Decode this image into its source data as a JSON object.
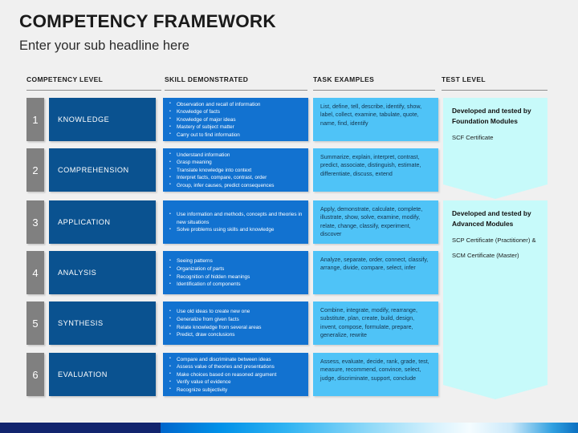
{
  "header": {
    "title": "COMPETENCY FRAMEWORK",
    "subtitle": "Enter your sub headline here"
  },
  "columns": {
    "level": "COMPETENCY LEVEL",
    "skill": "SKILL DEMONSTRATED",
    "task": "TASK EXAMPLES",
    "test": "TEST LEVEL"
  },
  "colors": {
    "background": "#f0f0f0",
    "number_box": "#808080",
    "level_box": "#0A5290",
    "skill_box": "#1272D0",
    "task_box": "#4FC3F7",
    "banner": "#C7FAFA",
    "bar_navy": "#12246e"
  },
  "rows": [
    {
      "number": "1",
      "level": "KNOWLEDGE",
      "skills": [
        "Observation and recall of information",
        "Knowledge of facts",
        "Knowledge of major ideas",
        "Mastery of subject matter",
        "Carry out to find information"
      ],
      "tasks": "List, define, tell, describe, identify, show, label, collect, examine, tabulate, quote, name, find, identify"
    },
    {
      "number": "2",
      "level": "COMPREHENSION",
      "skills": [
        "Understand information",
        "Grasp meaning",
        "Translate knowledge into context",
        "Interpret facts, compare, contrast, order",
        "Group, infer causes, predict consequences"
      ],
      "tasks": "Summarize, explain, interpret, contrast, predict, associate, distinguish, estimate, differentiate, discuss, extend"
    },
    {
      "number": "3",
      "level": "APPLICATION",
      "skills": [
        "Use information and methods, concepts and theories in new situations",
        "Solve problems using skills and knowledge"
      ],
      "tasks": "Apply, demonstrate, calculate, complete, illustrate, show, solve, examine, modify, relate, change, classify, experiment, discover"
    },
    {
      "number": "4",
      "level": "ANALYSIS",
      "skills": [
        "Seeing patterns",
        "Organization of parts",
        "Recognition of hidden meanings",
        "Identification of components"
      ],
      "tasks": "Analyze, separate, order, connect, classify, arrange, divide, compare, select, infer"
    },
    {
      "number": "5",
      "level": "SYNTHESIS",
      "skills": [
        "Use old ideas to create new one",
        "Generalize from given facts",
        "Relate knowledge from several areas",
        "Predict, draw conclusions"
      ],
      "tasks": "Combine, integrate, modify, rearrange, substitute, plan, create, build, design, invent, compose, formulate, prepare, generalize, rewrite"
    },
    {
      "number": "6",
      "level": "EVALUATION",
      "skills": [
        "Compare and discriminate between ideas",
        "Assess value of theories and presentations",
        "Make choices based on reasoned argument",
        "Verify value of evidence",
        "Recognize subjectivity"
      ],
      "tasks": "Assess, evaluate, decide, rank, grade, test, measure, recommend, convince, select, judge, discriminate, support, conclude"
    }
  ],
  "test_levels": [
    {
      "title": "Developed and tested by Foundation Modules",
      "certificates": [
        "SCF Certificate"
      ]
    },
    {
      "title": "Developed and tested by Advanced Modules",
      "certificates": [
        "SCP Certificate (Practitioner) &",
        "SCM Certificate (Master)"
      ]
    }
  ]
}
